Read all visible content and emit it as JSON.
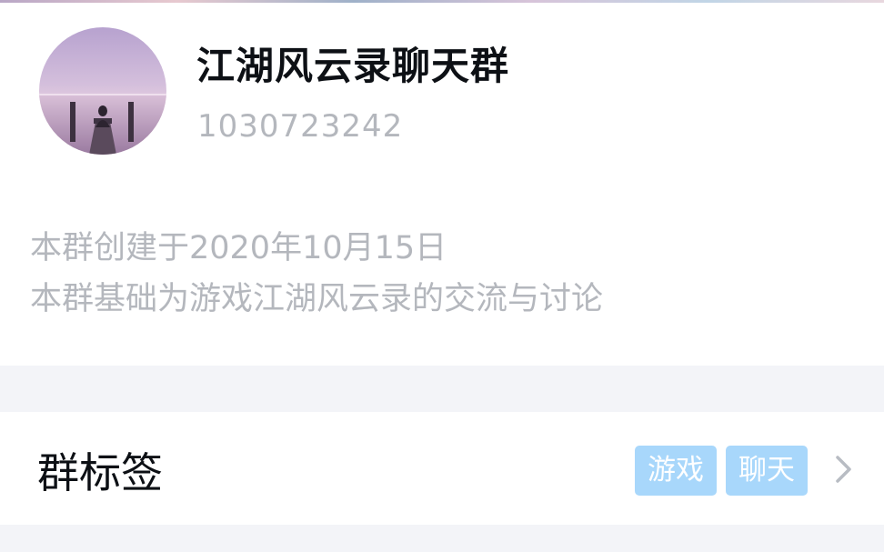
{
  "group": {
    "name": "江湖风云录聊天群",
    "id": "1030723242",
    "avatar_icon": "group-avatar-lake-photo"
  },
  "description": {
    "lines": [
      "本群创建于2020年10月15日",
      "本群基础为游戏江湖风云录的交流与讨论"
    ]
  },
  "tags_row": {
    "label": "群标签",
    "tags": [
      "游戏",
      "聊天"
    ],
    "chevron_icon": "chevron-right-icon"
  },
  "colors": {
    "tag_bg": "#a8d7fb",
    "muted_text": "#b4b7bd",
    "primary_text": "#0d1015",
    "page_bg": "#f3f4f8"
  }
}
